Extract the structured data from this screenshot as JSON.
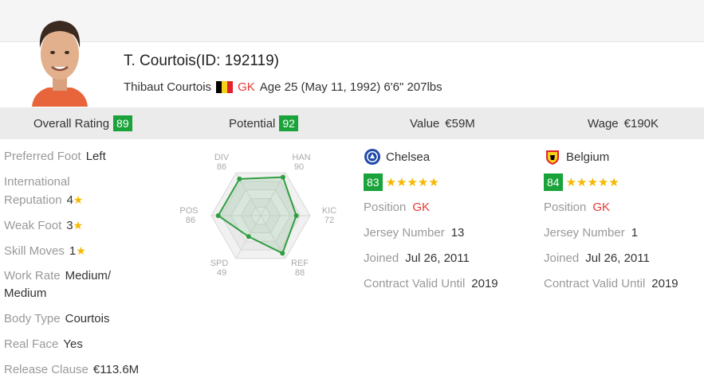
{
  "player": {
    "title": "T. Courtois(ID: 192119)",
    "full_name": "Thibaut Courtois",
    "nation_flag_icon": "belgium-flag-icon",
    "position": "GK",
    "age_text": "Age 25 (May 11, 1992) 6'6\" 207lbs"
  },
  "stats_bar": {
    "overall_label": "Overall Rating",
    "overall_value": "89",
    "potential_label": "Potential",
    "potential_value": "92",
    "value_label": "Value",
    "value_value": "€59M",
    "wage_label": "Wage",
    "wage_value": "€190K"
  },
  "attributes": {
    "preferred_foot_label": "Preferred Foot",
    "preferred_foot_value": "Left",
    "intl_rep_label_1": "International",
    "intl_rep_label_2": "Reputation",
    "intl_rep_value": "4",
    "weak_foot_label": "Weak Foot",
    "weak_foot_value": "3",
    "skill_moves_label": "Skill Moves",
    "skill_moves_value": "1",
    "work_rate_label": "Work Rate",
    "work_rate_value_1": "Medium/",
    "work_rate_value_2": "Medium",
    "body_type_label": "Body Type",
    "body_type_value": "Courtois",
    "real_face_label": "Real Face",
    "real_face_value": "Yes",
    "release_clause_label": "Release Clause",
    "release_clause_value": "€113.6M"
  },
  "radar": {
    "max": 100,
    "axes": [
      {
        "key": "DIV",
        "value": 86
      },
      {
        "key": "HAN",
        "value": 90
      },
      {
        "key": "KIC",
        "value": 72
      },
      {
        "key": "REF",
        "value": 88
      },
      {
        "key": "SPD",
        "value": 49
      },
      {
        "key": "POS",
        "value": 86
      }
    ],
    "labels": {
      "div_key": "DIV",
      "div_val": "86",
      "han_key": "HAN",
      "han_val": "90",
      "kic_key": "KIC",
      "kic_val": "72",
      "ref_key": "REF",
      "ref_val": "88",
      "spd_key": "SPD",
      "spd_val": "49",
      "pos_key": "POS",
      "pos_val": "86"
    },
    "stroke_color": "#2e9e3f",
    "fill_color": "#2e9e3f"
  },
  "club": {
    "name": "Chelsea",
    "crest_icon": "chelsea-crest-icon",
    "rating": "83",
    "stars": "★★★★★",
    "position_label": "Position",
    "position_value": "GK",
    "jersey_label": "Jersey Number",
    "jersey_value": "13",
    "joined_label": "Joined",
    "joined_value": "Jul 26, 2011",
    "contract_label": "Contract Valid Until",
    "contract_value": "2019"
  },
  "national": {
    "name": "Belgium",
    "crest_icon": "belgium-crest-icon",
    "rating": "84",
    "stars": "★★★★★",
    "position_label": "Position",
    "position_value": "GK",
    "jersey_label": "Jersey Number",
    "jersey_value": "1",
    "joined_label": "Joined",
    "joined_value": "Jul 26, 2011",
    "contract_label": "Contract Valid Until",
    "contract_value": "2019"
  },
  "colors": {
    "badge_green": "#1aa33a",
    "gk_red": "#e53935",
    "star_gold": "#f5b800"
  }
}
